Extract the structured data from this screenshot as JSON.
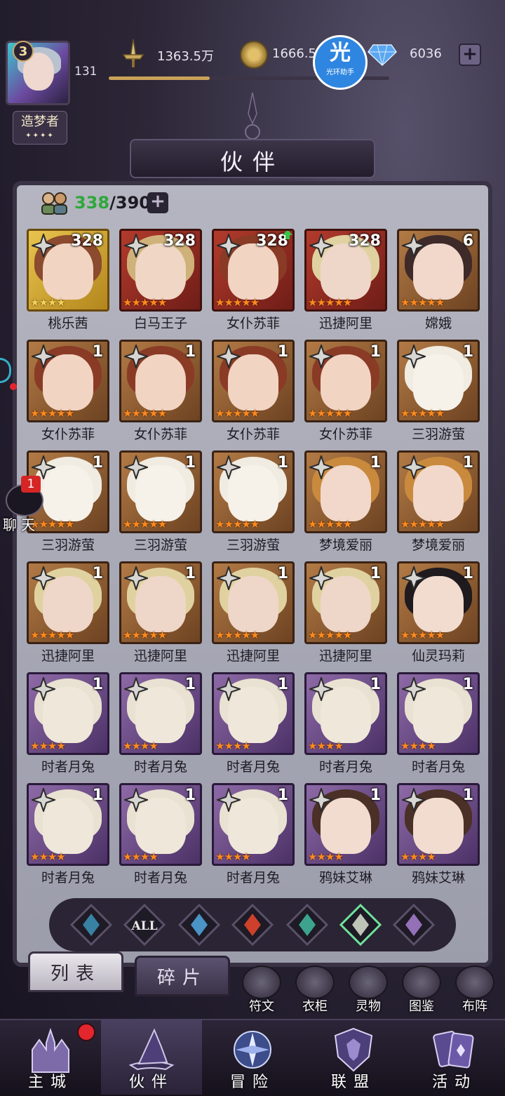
{
  "player": {
    "badge_level": "3",
    "level": "131",
    "title": "造梦者",
    "title_stars": "✦✦✦✦"
  },
  "resources": {
    "power": "1363.5万",
    "gold": "1666.5",
    "gems": "6036",
    "xp_progress": 0.36
  },
  "assistant": {
    "glyph": "光",
    "label": "光环助手"
  },
  "header": {
    "title": "伙伴"
  },
  "partner_count": {
    "current": "338",
    "max": "/390"
  },
  "cards": [
    {
      "name": "桃乐茜",
      "level": "328",
      "frame": "gold",
      "stars": "★★★★",
      "star_color": "yellow",
      "hair": "#8c4a2e",
      "skin": "#f2d4c2",
      "upgrade": false
    },
    {
      "name": "白马王子",
      "level": "328",
      "frame": "red",
      "stars": "★★★★★",
      "star_color": "orange",
      "hair": "#cfb27a",
      "skin": "#f0d6c4",
      "upgrade": false
    },
    {
      "name": "女仆苏菲",
      "level": "328",
      "frame": "red",
      "stars": "★★★★★",
      "star_color": "orange",
      "hair": "#8a3b26",
      "skin": "#f2d4c2",
      "upgrade": true
    },
    {
      "name": "迅捷阿里",
      "level": "328",
      "frame": "red",
      "stars": "★★★★★",
      "star_color": "orange",
      "hair": "#e0d2a0",
      "skin": "#eed6c8",
      "upgrade": false
    },
    {
      "name": "嫦娥",
      "level": "6",
      "frame": "brown",
      "stars": "★★★★★",
      "star_color": "orange",
      "hair": "#3f2a2a",
      "skin": "#f2d8ca",
      "upgrade": false
    },
    {
      "name": "女仆苏菲",
      "level": "1",
      "frame": "brown",
      "stars": "★★★★★",
      "star_color": "orange",
      "hair": "#8a3b26",
      "skin": "#f2d4c2",
      "upgrade": false
    },
    {
      "name": "女仆苏菲",
      "level": "1",
      "frame": "brown",
      "stars": "★★★★★",
      "star_color": "orange",
      "hair": "#8a3b26",
      "skin": "#f2d4c2",
      "upgrade": false
    },
    {
      "name": "女仆苏菲",
      "level": "1",
      "frame": "brown",
      "stars": "★★★★★",
      "star_color": "orange",
      "hair": "#8a3b26",
      "skin": "#f2d4c2",
      "upgrade": false
    },
    {
      "name": "女仆苏菲",
      "level": "1",
      "frame": "brown",
      "stars": "★★★★★",
      "star_color": "orange",
      "hair": "#8a3b26",
      "skin": "#f2d4c2",
      "upgrade": false
    },
    {
      "name": "三羽游萤",
      "level": "1",
      "frame": "brown",
      "stars": "★★★★★",
      "star_color": "orange",
      "hair": "#f1ece2",
      "skin": "#f6f2ea",
      "upgrade": false
    },
    {
      "name": "三羽游萤",
      "level": "1",
      "frame": "brown",
      "stars": "★★★★★",
      "star_color": "orange",
      "hair": "#f1ece2",
      "skin": "#f6f2ea",
      "upgrade": false
    },
    {
      "name": "三羽游萤",
      "level": "1",
      "frame": "brown",
      "stars": "★★★★★",
      "star_color": "orange",
      "hair": "#f1ece2",
      "skin": "#f6f2ea",
      "upgrade": false
    },
    {
      "name": "三羽游萤",
      "level": "1",
      "frame": "brown",
      "stars": "★★★★★",
      "star_color": "orange",
      "hair": "#f1ece2",
      "skin": "#f6f2ea",
      "upgrade": false
    },
    {
      "name": "梦境爱丽",
      "level": "1",
      "frame": "brown",
      "stars": "★★★★★",
      "star_color": "orange",
      "hair": "#c98a3e",
      "skin": "#f2d8ca",
      "upgrade": false
    },
    {
      "name": "梦境爱丽",
      "level": "1",
      "frame": "brown",
      "stars": "★★★★★",
      "star_color": "orange",
      "hair": "#c98a3e",
      "skin": "#f2d8ca",
      "upgrade": false
    },
    {
      "name": "迅捷阿里",
      "level": "1",
      "frame": "brown",
      "stars": "★★★★★",
      "star_color": "orange",
      "hair": "#e0d2a0",
      "skin": "#eed6c8",
      "upgrade": false
    },
    {
      "name": "迅捷阿里",
      "level": "1",
      "frame": "brown",
      "stars": "★★★★★",
      "star_color": "orange",
      "hair": "#e0d2a0",
      "skin": "#eed6c8",
      "upgrade": false
    },
    {
      "name": "迅捷阿里",
      "level": "1",
      "frame": "brown",
      "stars": "★★★★★",
      "star_color": "orange",
      "hair": "#e0d2a0",
      "skin": "#eed6c8",
      "upgrade": false
    },
    {
      "name": "迅捷阿里",
      "level": "1",
      "frame": "brown",
      "stars": "★★★★★",
      "star_color": "orange",
      "hair": "#e0d2a0",
      "skin": "#eed6c8",
      "upgrade": false
    },
    {
      "name": "仙灵玛莉",
      "level": "1",
      "frame": "brown",
      "stars": "★★★★★",
      "star_color": "orange",
      "hair": "#1e1a1e",
      "skin": "#f2dccf",
      "upgrade": false
    },
    {
      "name": "时者月兔",
      "level": "1",
      "frame": "purple",
      "stars": "★★★★",
      "star_color": "orange",
      "hair": "#e9e2d2",
      "skin": "#efe8da",
      "upgrade": false
    },
    {
      "name": "时者月兔",
      "level": "1",
      "frame": "purple",
      "stars": "★★★★",
      "star_color": "orange",
      "hair": "#e9e2d2",
      "skin": "#efe8da",
      "upgrade": false
    },
    {
      "name": "时者月兔",
      "level": "1",
      "frame": "purple",
      "stars": "★★★★",
      "star_color": "orange",
      "hair": "#e9e2d2",
      "skin": "#efe8da",
      "upgrade": false
    },
    {
      "name": "时者月兔",
      "level": "1",
      "frame": "purple",
      "stars": "★★★★",
      "star_color": "orange",
      "hair": "#e9e2d2",
      "skin": "#efe8da",
      "upgrade": false
    },
    {
      "name": "时者月兔",
      "level": "1",
      "frame": "purple",
      "stars": "★★★★",
      "star_color": "orange",
      "hair": "#e9e2d2",
      "skin": "#efe8da",
      "upgrade": false
    },
    {
      "name": "时者月兔",
      "level": "1",
      "frame": "purple",
      "stars": "★★★★",
      "star_color": "orange",
      "hair": "#e9e2d2",
      "skin": "#efe8da",
      "upgrade": false
    },
    {
      "name": "时者月兔",
      "level": "1",
      "frame": "purple",
      "stars": "★★★★",
      "star_color": "orange",
      "hair": "#e9e2d2",
      "skin": "#efe8da",
      "upgrade": false
    },
    {
      "name": "时者月兔",
      "level": "1",
      "frame": "purple",
      "stars": "★★★★",
      "star_color": "orange",
      "hair": "#e9e2d2",
      "skin": "#efe8da",
      "upgrade": false
    },
    {
      "name": "鸦妹艾琳",
      "level": "1",
      "frame": "purple",
      "stars": "★★★★",
      "star_color": "orange",
      "hair": "#4a3026",
      "skin": "#f2dccf",
      "upgrade": false
    },
    {
      "name": "鸦妹艾琳",
      "level": "1",
      "frame": "purple",
      "stars": "★★★★",
      "star_color": "orange",
      "hair": "#4a3026",
      "skin": "#f2dccf",
      "upgrade": false
    }
  ],
  "filters": [
    {
      "id": "faction-1",
      "label": "",
      "color": "#3b8db0"
    },
    {
      "id": "all",
      "label": "ALL",
      "color": "#e8e8e8"
    },
    {
      "id": "water",
      "label": "",
      "color": "#4fa2d8"
    },
    {
      "id": "fire",
      "label": "",
      "color": "#e0452c"
    },
    {
      "id": "wind",
      "label": "",
      "color": "#3fb39a"
    },
    {
      "id": "light",
      "label": "",
      "color": "#cfd7c8"
    },
    {
      "id": "dark",
      "label": "",
      "color": "#a07ac8"
    }
  ],
  "tabs": {
    "list": "列表",
    "fragments": "碎片"
  },
  "functions": [
    "符文",
    "衣柜",
    "灵物",
    "图鉴",
    "布阵"
  ],
  "nav": [
    "主城",
    "伙伴",
    "冒险",
    "联盟",
    "活动"
  ],
  "chat": {
    "label": "聊天",
    "badge": "1"
  }
}
